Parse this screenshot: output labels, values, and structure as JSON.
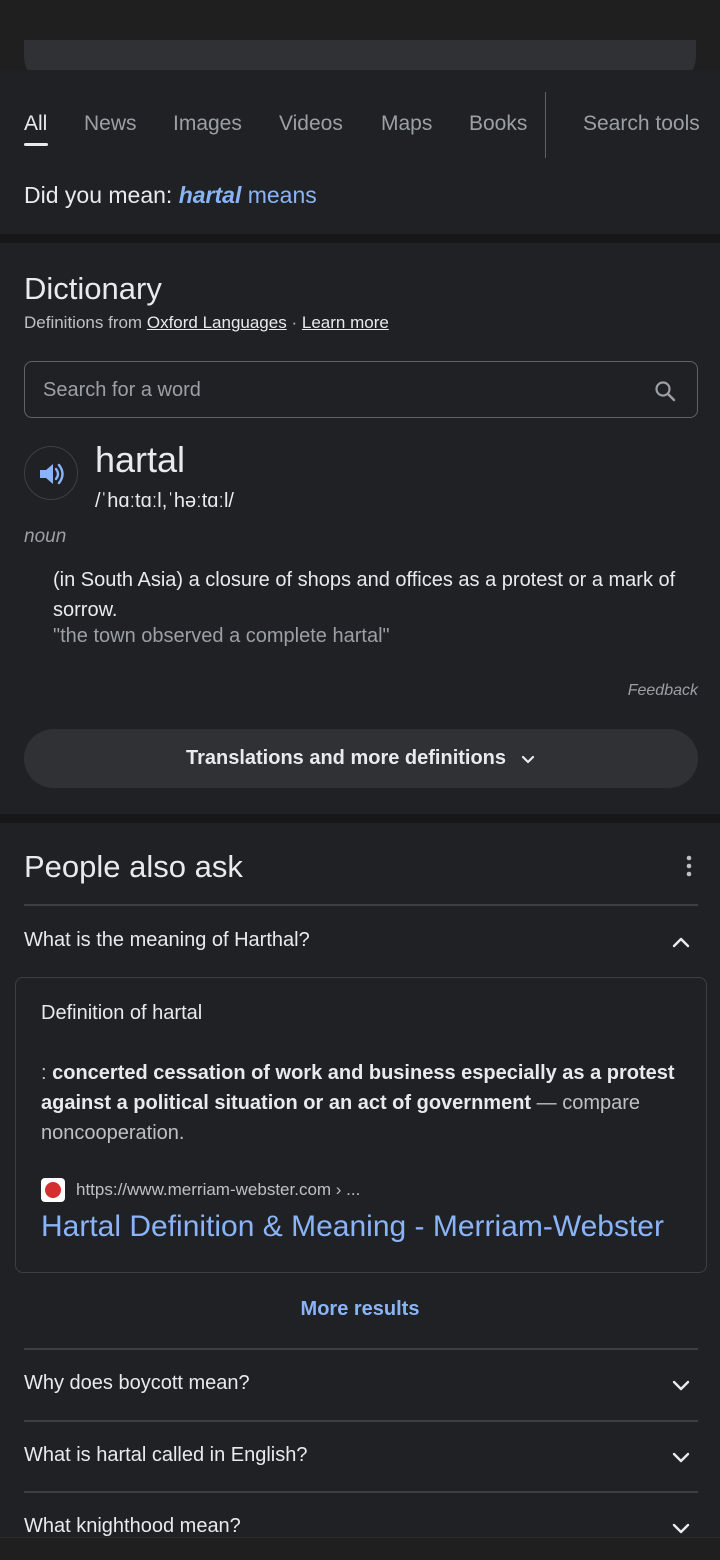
{
  "tabs": [
    {
      "label": "All",
      "active": true
    },
    {
      "label": "News"
    },
    {
      "label": "Images"
    },
    {
      "label": "Videos"
    },
    {
      "label": "Maps"
    },
    {
      "label": "Books"
    },
    {
      "label": "Search tools"
    }
  ],
  "did_you_mean": {
    "prefix": "Did you mean:",
    "correction": "hartal",
    "rest": "means"
  },
  "dictionary": {
    "title": "Dictionary",
    "source_prefix": "Definitions from",
    "source_name": "Oxford Languages",
    "separator": "·",
    "learn_more": "Learn more",
    "search_placeholder": "Search for a word",
    "word": "hartal",
    "phonetic": "/ˈhɑːtɑːl,ˈhəːtɑːl/",
    "part_of_speech": "noun",
    "definition": "(in South Asia) a closure of shops and offices as a protest or a mark of sorrow.",
    "example": "\"the town observed a complete hartal\"",
    "feedback": "Feedback",
    "more_button": "Translations and more definitions"
  },
  "paa": {
    "title": "People also ask",
    "expanded_question": "What is the meaning of Harthal?",
    "answer": {
      "heading": "Definition of hartal",
      "colon": ":",
      "bold_text": "concerted cessation of work and business especially as a protest against a political situation or an act of government",
      "rest_text": "— compare noncooperation.",
      "url": "https://www.merriam-webster.com › ...",
      "link_title": "Hartal Definition & Meaning - Merriam-Webster"
    },
    "more_results": "More results",
    "questions": [
      "Why does boycott mean?",
      "What is hartal called in English?",
      "What knighthood mean?"
    ]
  },
  "colors": {
    "background": "#202124",
    "link": "#8ab4f8",
    "separator": "#171717"
  }
}
